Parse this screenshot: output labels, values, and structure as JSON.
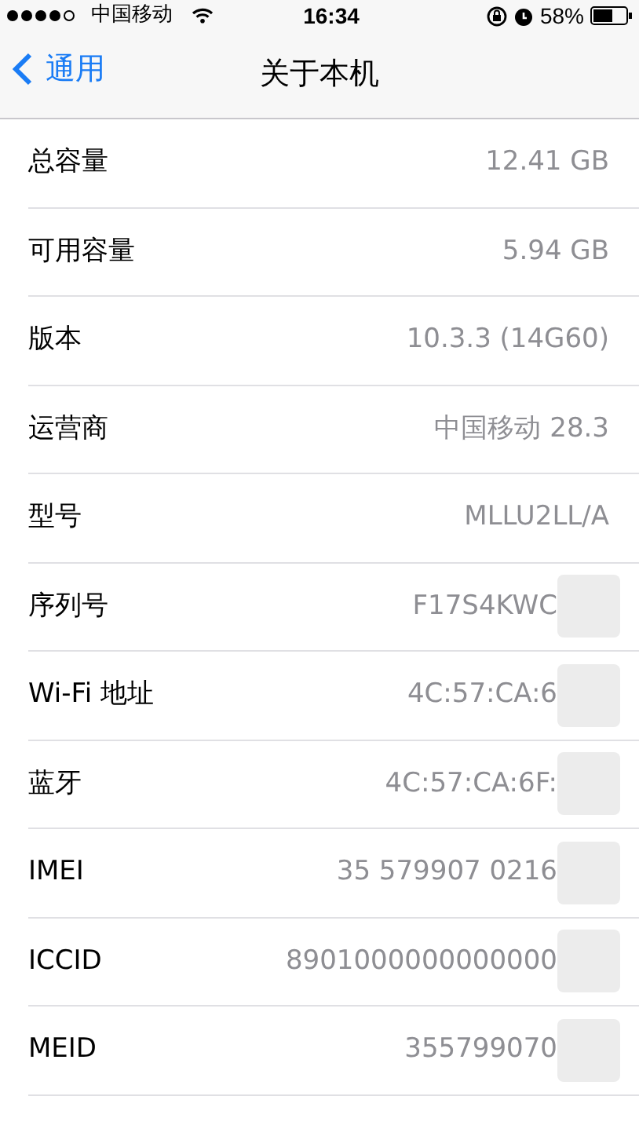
{
  "status_bar": {
    "carrier": "中国移动",
    "time": "16:34",
    "battery": "58%"
  },
  "nav": {
    "back": "通用",
    "title": "关于本机"
  },
  "rows": [
    {
      "label": "总容量",
      "value": "12.41 GB",
      "redacted": false
    },
    {
      "label": "可用容量",
      "value": "5.94 GB",
      "redacted": false
    },
    {
      "label": "版本",
      "value": "10.3.3 (14G60)",
      "redacted": false
    },
    {
      "label": "运营商",
      "value": "中国移动 28.3",
      "redacted": false
    },
    {
      "label": "型号",
      "value": "MLLU2LL/A",
      "redacted": false
    },
    {
      "label": "序列号",
      "value": "F17S4KWC",
      "redacted": true
    },
    {
      "label": "Wi-Fi 地址",
      "value": "4C:57:CA:6",
      "redacted": true
    },
    {
      "label": "蓝牙",
      "value": "4C:57:CA:6F:",
      "redacted": true
    },
    {
      "label": "IMEI",
      "value": "35 579907 0216",
      "redacted": true
    },
    {
      "label": "ICCID",
      "value": "8901000000000000",
      "redacted": true
    },
    {
      "label": "MEID",
      "value": "355799070",
      "redacted": true
    }
  ]
}
